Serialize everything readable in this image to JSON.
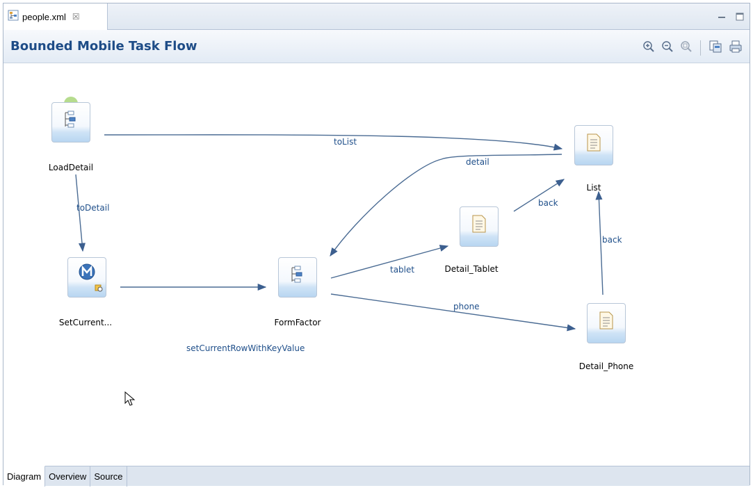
{
  "editor_tab": {
    "file_name": "people.xml",
    "close_glyph": "☒"
  },
  "header": {
    "title": "Bounded Mobile Task Flow"
  },
  "toolbar": {
    "zoom_in_icon": "zoom-in-icon",
    "zoom_out_icon": "zoom-out-icon",
    "zoom_fit_icon": "zoom-fit-icon",
    "export_icon": "export-icon",
    "print_icon": "print-icon"
  },
  "diagram": {
    "nodes": {
      "load_detail": "LoadDetail",
      "set_current": "SetCurrent...",
      "form_factor": "FormFactor",
      "detail_tablet": "Detail_Tablet",
      "list": "List",
      "detail_phone": "Detail_Phone"
    },
    "edges": {
      "to_list": "toList",
      "to_detail": "toDetail",
      "detail": "detail",
      "tablet": "tablet",
      "phone": "phone",
      "back_tablet": "back",
      "back_phone": "back",
      "set_current_row": "setCurrentRowWithKeyValue"
    }
  },
  "bottom_tabs": [
    "Diagram",
    "Overview",
    "Source"
  ],
  "colors": {
    "title": "#1e4c87",
    "edge": "#4a6b93",
    "edge_label": "#1f4f8a",
    "start_marker": "#b6dc8e"
  }
}
